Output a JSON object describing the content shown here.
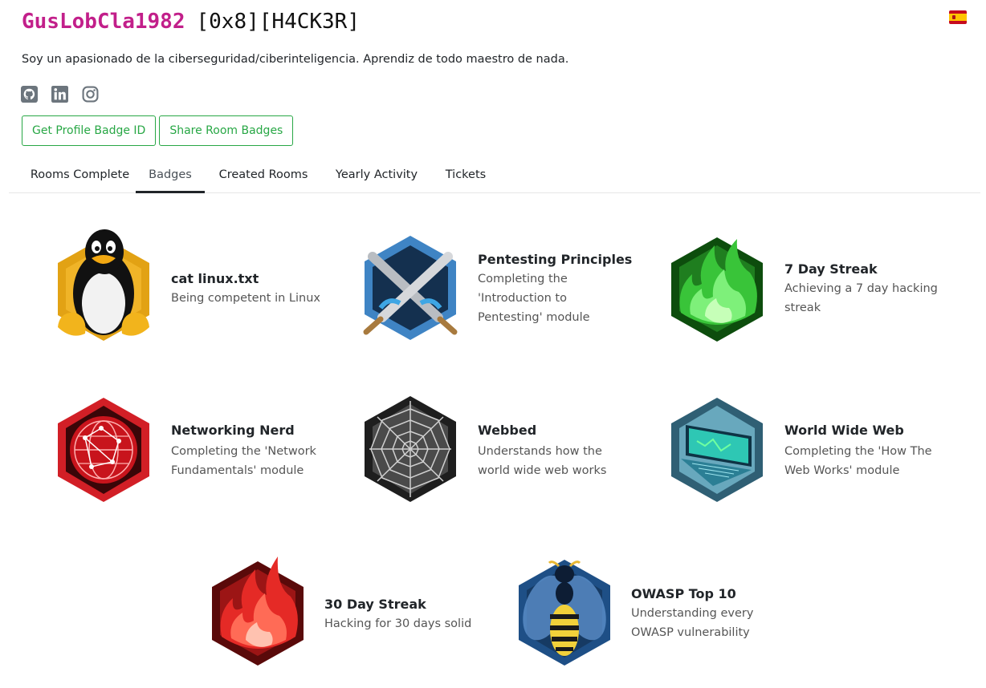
{
  "profile": {
    "username": "GusLobCla1982",
    "rank": "[0x8][H4CK3R]",
    "bio": "Soy un apasionado de la ciberseguridad/ciberinteligencia. Aprendiz de todo maestro de nada.",
    "flag_icon": "spain-flag-icon"
  },
  "socials": [
    "github-icon",
    "linkedin-icon",
    "instagram-icon"
  ],
  "actions": {
    "profile_badge_label": "Get Profile Badge ID",
    "share_badges_label": "Share Room Badges"
  },
  "tabs": [
    {
      "label": "Rooms Complete",
      "active": false
    },
    {
      "label": "Badges",
      "active": true
    },
    {
      "label": "Created Rooms",
      "active": false
    },
    {
      "label": "Yearly Activity",
      "active": false
    },
    {
      "label": "Tickets",
      "active": false
    }
  ],
  "badges": [
    {
      "title": "cat linux.txt",
      "desc": [
        "Being competent in Linux"
      ],
      "icon": "linux-penguin-icon"
    },
    {
      "title": "Pentesting Principles",
      "desc": [
        "Completing the",
        "'Introduction to",
        "Pentesting' module"
      ],
      "icon": "crossed-swords-icon"
    },
    {
      "title": "7 Day Streak",
      "desc": [
        "Achieving a 7 day hacking",
        "streak"
      ],
      "icon": "green-flame-icon"
    },
    {
      "title": "Networking Nerd",
      "desc": [
        "Completing the 'Network",
        "Fundamentals' module"
      ],
      "icon": "network-globe-icon"
    },
    {
      "title": "Webbed",
      "desc": [
        "Understands how the",
        "world wide web works"
      ],
      "icon": "spider-web-icon"
    },
    {
      "title": "World Wide Web",
      "desc": [
        "Completing the 'How The",
        "Web Works' module"
      ],
      "icon": "laptop-icon"
    },
    {
      "title": "30 Day Streak",
      "desc": [
        "Hacking for 30 days solid"
      ],
      "icon": "red-flame-icon"
    },
    {
      "title": "OWASP Top 10",
      "desc": [
        "Understanding every",
        "OWASP vulnerability"
      ],
      "icon": "wasp-icon"
    }
  ],
  "colors": {
    "username": "#c21f8a",
    "button_green": "#28a745"
  }
}
